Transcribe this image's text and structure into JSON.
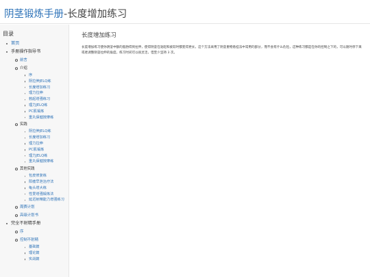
{
  "header": {
    "brand": "阴茎锻炼手册",
    "separator": "-",
    "page_title": "长度增加练习"
  },
  "sidebar": {
    "title": "目录",
    "items": [
      {
        "level": 1,
        "label": "首页",
        "link": true
      },
      {
        "level": 1,
        "label": "手册操作指导书",
        "link": false
      },
      {
        "level": 2,
        "label": "前言",
        "link": true
      },
      {
        "level": 2,
        "label": "介绍",
        "link": false
      },
      {
        "level": 3,
        "label": "序",
        "link": true
      },
      {
        "level": 3,
        "label": "阴拉伸JELQ练",
        "link": true
      },
      {
        "level": 3,
        "label": "长度增加练习",
        "link": true
      },
      {
        "level": 3,
        "label": "理力拉伸",
        "link": true
      },
      {
        "level": 3,
        "label": "勃起增强练习",
        "link": true
      },
      {
        "level": 3,
        "label": "理力JELQ练",
        "link": true
      },
      {
        "level": 3,
        "label": "PC肌锻炼",
        "link": true
      },
      {
        "level": 3,
        "label": "重丸保健按摩练",
        "link": true
      },
      {
        "level": 2,
        "label": "实践",
        "link": false
      },
      {
        "level": 3,
        "label": "阴拉伸JELQ练",
        "link": true
      },
      {
        "level": 3,
        "label": "长度增加练习",
        "link": true
      },
      {
        "level": 3,
        "label": "理力拉伸",
        "link": true
      },
      {
        "level": 3,
        "label": "PC肌锻炼",
        "link": true
      },
      {
        "level": 3,
        "label": "理力JELQ练",
        "link": true
      },
      {
        "level": 3,
        "label": "重丸保健按摩练",
        "link": true
      },
      {
        "level": 2,
        "label": "其他实践",
        "link": false
      },
      {
        "level": 3,
        "label": "包皮修复练",
        "link": true
      },
      {
        "level": 3,
        "label": "阳痿早泄治疗法",
        "link": true
      },
      {
        "level": 3,
        "label": "龟头增大练",
        "link": true
      },
      {
        "level": 3,
        "label": "性爱增强锻炼法",
        "link": true
      },
      {
        "level": 3,
        "label": "延迟射精能力增强练习",
        "link": true
      },
      {
        "level": 2,
        "label": "周赛计划",
        "link": true
      },
      {
        "level": 2,
        "label": "高级计划书",
        "link": true
      },
      {
        "level": 1,
        "label": "完全不射精手册",
        "link": false
      },
      {
        "level": 2,
        "label": "序",
        "link": true
      },
      {
        "level": 2,
        "label": "控制不射精",
        "link": true
      },
      {
        "level": 3,
        "label": "基础篇",
        "link": true
      },
      {
        "level": 3,
        "label": "理论篇",
        "link": true
      },
      {
        "level": 3,
        "label": "实战篇",
        "link": true
      }
    ]
  },
  "main": {
    "title": "长度增加练习",
    "body": "长度增加练习使你阴茎中额的脂肪得到拉伸，使得阴茎在勃起和疲软时都变得更长，这个方法采用了阴茎重物悬挂法中常用的部分，而不会有什么危险，这种练习都是在你的控制之下的，可以随时停下来或者调整阴茎拉伸的角度，练习时间可以很灵活，但至少坚持 3 次。"
  }
}
